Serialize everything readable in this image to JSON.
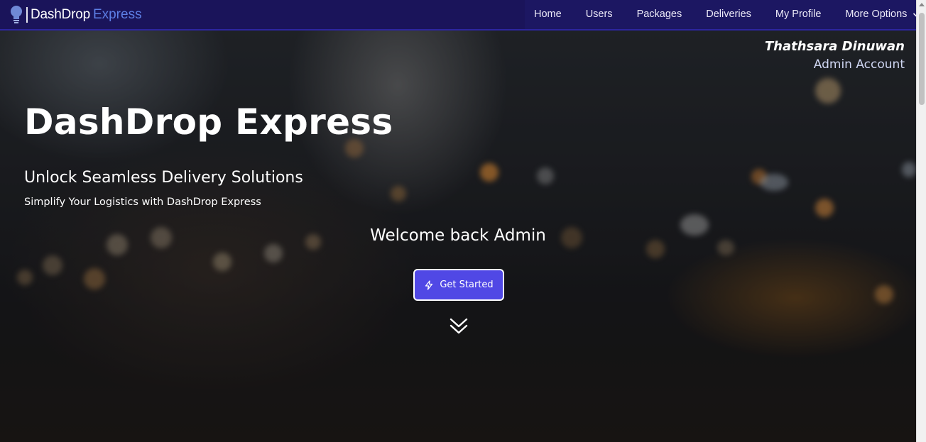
{
  "brand": {
    "name": "DashDrop",
    "accent": "Express",
    "logo_icon": "lightbulb-icon",
    "accent_color": "#5d7fe6"
  },
  "nav": {
    "items": [
      {
        "label": "Home"
      },
      {
        "label": "Users"
      },
      {
        "label": "Packages"
      },
      {
        "label": "Deliveries"
      },
      {
        "label": "My Profile"
      },
      {
        "label": "More Options",
        "icon": "chevron-down-icon"
      }
    ],
    "background": "#1a145a"
  },
  "account": {
    "name": "Thathsara Dinuwan",
    "role": "Admin Account"
  },
  "hero": {
    "title": "DashDrop Express",
    "subtitle": "Unlock Seamless Delivery Solutions",
    "tagline": "Simplify Your Logistics with DashDrop Express",
    "welcome": "Welcome back Admin",
    "cta": {
      "label": "Get Started",
      "icon": "bolt-icon",
      "color": "#5048e5"
    },
    "scroll_icon": "double-chevron-down-icon"
  }
}
